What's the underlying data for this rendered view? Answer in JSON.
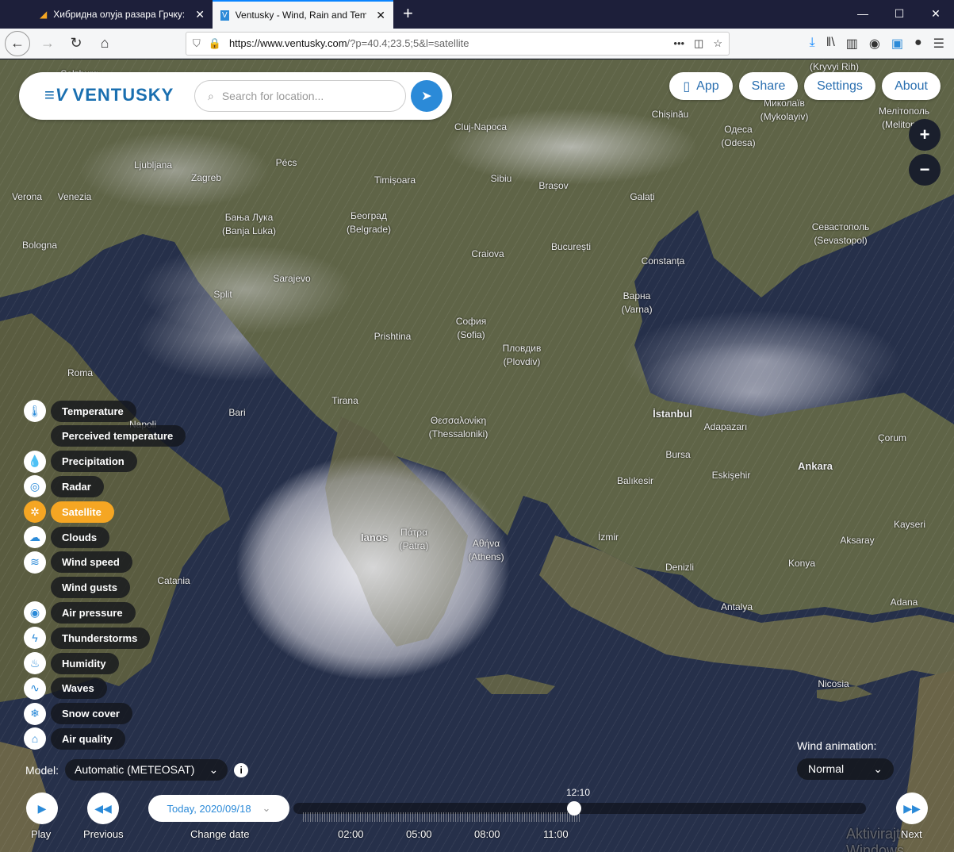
{
  "browser": {
    "tabs": [
      {
        "title": "Хибридна олуја разара Грчку:"
      },
      {
        "title": "Ventusky - Wind, Rain and Tem"
      }
    ],
    "url_host": "https://www.ventusky.com",
    "url_path": "/?p=40.4;23.5;5&l=satellite"
  },
  "header": {
    "logo": "VENTUSKY",
    "search_placeholder": "Search for location..."
  },
  "top_buttons": {
    "app": "App",
    "share": "Share",
    "settings": "Settings",
    "about": "About"
  },
  "zoom": {
    "in": "+",
    "out": "−"
  },
  "layers": [
    {
      "label": "Temperature",
      "icon": "thermometer-icon"
    },
    {
      "label": "Perceived temperature",
      "icon": ""
    },
    {
      "label": "Precipitation",
      "icon": "drop-icon"
    },
    {
      "label": "Radar",
      "icon": "radar-icon"
    },
    {
      "label": "Satellite",
      "icon": "satellite-icon",
      "active": true
    },
    {
      "label": "Clouds",
      "icon": "cloud-icon"
    },
    {
      "label": "Wind speed",
      "icon": "wind-icon"
    },
    {
      "label": "Wind gusts",
      "icon": ""
    },
    {
      "label": "Air pressure",
      "icon": "pressure-icon"
    },
    {
      "label": "Thunderstorms",
      "icon": "lightning-icon"
    },
    {
      "label": "Humidity",
      "icon": "humidity-icon"
    },
    {
      "label": "Waves",
      "icon": "waves-icon"
    },
    {
      "label": "Snow cover",
      "icon": "snowflake-icon"
    },
    {
      "label": "Air quality",
      "icon": "factory-icon"
    }
  ],
  "model": {
    "label": "Model:",
    "value": "Automatic (METEOSAT)"
  },
  "wind_animation": {
    "label": "Wind animation:",
    "value": "Normal"
  },
  "timeline": {
    "play": "Play",
    "previous": "Previous",
    "next": "Next",
    "date": "Today, 2020/09/18",
    "change_date": "Change date",
    "current_time": "12:10",
    "progress": 0.49,
    "hours": [
      "02:00",
      "05:00",
      "08:00",
      "11:00"
    ]
  },
  "map": {
    "cities": [
      "Salzburg",
      "Ljubljana",
      "Zagreb",
      "Pécs",
      "Verona",
      "Venezia",
      "Bologna",
      "Бања Лука\n(Banja Luka)",
      "Београд\n(Belgrade)",
      "Timișoara",
      "Cluj-Napoca",
      "Sibiu",
      "Brașov",
      "Chișinău",
      "Одеса\n(Odesa)",
      "Миколаїв\n(Mykolayiv)",
      "Мелітополь\n(Melitopol)",
      "(Kryvyi Rih)",
      "Galați",
      "București",
      "Craiova",
      "Constanța",
      "Sarajevo",
      "Split",
      "Prishtina",
      "София\n(Sofia)",
      "Пловдив\n(Plovdiv)",
      "Варна\n(Varna)",
      "Севастополь\n(Sevastopol)",
      "Roma",
      "Napoli",
      "Tirana",
      "Θεσσαλονίκη\n(Thessaloniki)",
      "İstanbul",
      "Adapazarı",
      "Bursa",
      "Çorum",
      "Ankara",
      "Balıkesir",
      "Eskişehir",
      "Ianos",
      "Πάτρα\n(Patra)",
      "Αθήνα\n(Athens)",
      "İzmir",
      "Kayseri",
      "Aksaray",
      "Denizli",
      "Konya",
      "Catania",
      "Antalya",
      "Adana",
      "Nicosia",
      "Bari"
    ],
    "watermark": "Aktivirajte Windows"
  }
}
